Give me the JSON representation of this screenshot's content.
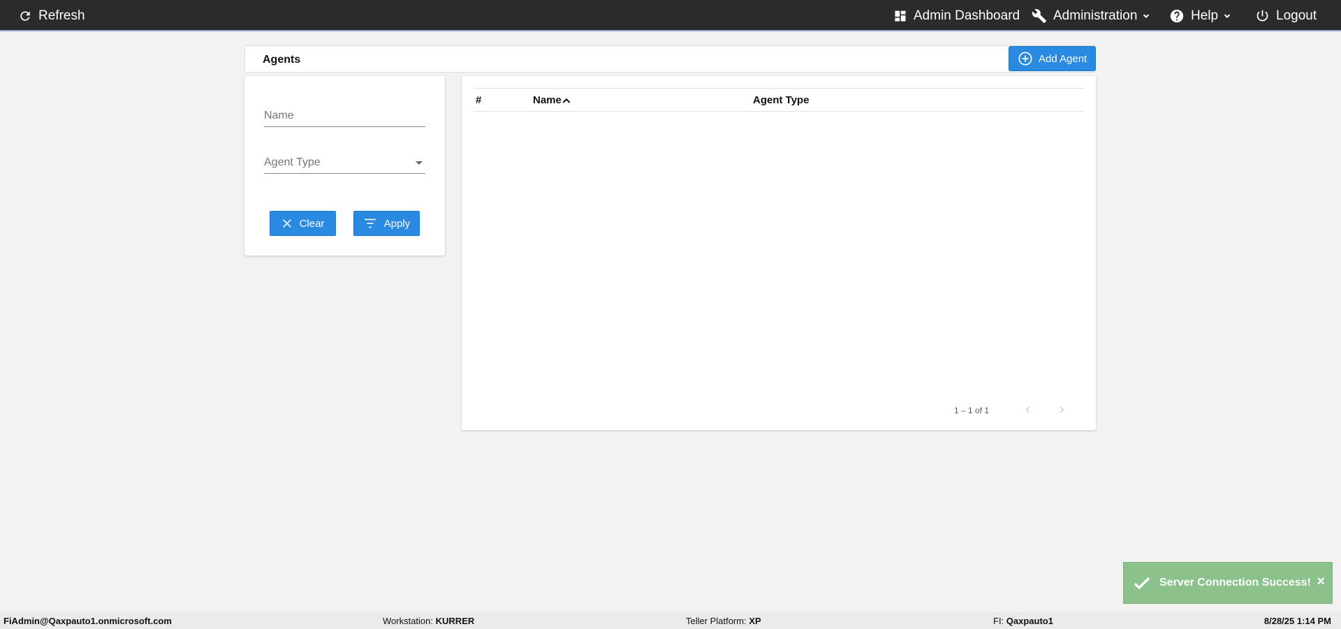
{
  "nav": {
    "refresh_label": "Refresh",
    "admin_dashboard_label": "Admin Dashboard",
    "administration_label": "Administration",
    "help_label": "Help",
    "logout_label": "Logout"
  },
  "page": {
    "title": "Agents",
    "add_button_label": "Add Agent"
  },
  "filters": {
    "name_placeholder": "Name",
    "agent_type_placeholder": "Agent Type",
    "clear_label": "Clear",
    "apply_label": "Apply"
  },
  "table": {
    "columns": [
      "#",
      "Name",
      "Agent Type"
    ],
    "sorted_column": "Name",
    "sort_direction": "ascending",
    "rows": [],
    "pagination_text": "1 – 1 of 1"
  },
  "toast": {
    "message": "Server Connection Success!",
    "close_glyph": "×"
  },
  "status": {
    "user": "FiAdmin@Qaxpauto1.onmicrosoft.com",
    "workstation_label": "Workstation:",
    "workstation_value": "KURRER",
    "teller_platform_label": "Teller Platform:",
    "teller_platform_value": "XP",
    "fi_label": "FI:",
    "fi_value": "Qaxpauto1",
    "datetime": "8/28/25 1:14 PM"
  },
  "colors": {
    "topbar": "#2b2b2b",
    "accent": "#2a89e0",
    "toast": "#8bc18a",
    "background": "#f2f2f3"
  },
  "icons": {
    "refresh": "refresh-icon",
    "dashboard": "dashboard-icon",
    "administration": "wrench-icon",
    "help": "help-icon",
    "logout": "power-icon",
    "add": "plus-circle-icon",
    "clear": "close-icon",
    "apply": "filter-icon",
    "toast": "check-icon"
  }
}
